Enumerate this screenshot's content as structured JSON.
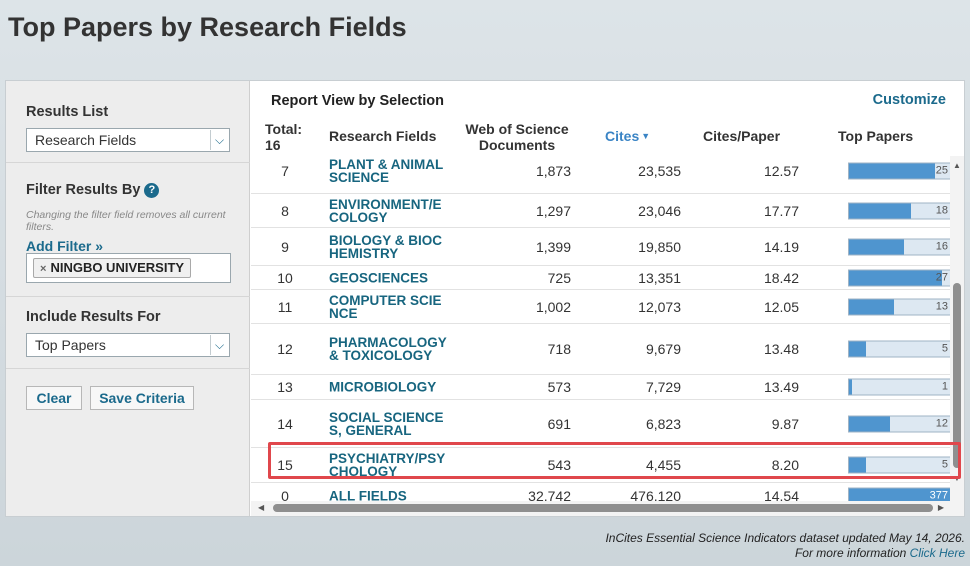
{
  "page": {
    "title": "Top Papers by Research Fields"
  },
  "sidebar": {
    "results_list_label": "Results List",
    "results_list_value": "Research Fields",
    "filter_label": "Filter Results By",
    "filter_help": "?",
    "filter_hint": "Changing the filter field removes all current filters.",
    "add_filter": "Add Filter »",
    "filter_chip_x": "×",
    "filter_chip": "NINGBO UNIVERSITY",
    "include_label": "Include Results For",
    "include_value": "Top Papers",
    "clear_button": "Clear",
    "save_button": "Save Criteria"
  },
  "report": {
    "title": "Report View by Selection",
    "customize": "Customize",
    "columns": {
      "total": "Total: 16",
      "field": "Research Fields",
      "docs": "Web of Science Documents",
      "cites": "Cites",
      "cites_sort": "▼",
      "cpp": "Cites/Paper",
      "top": "Top Papers"
    },
    "rows": [
      {
        "rank": "7",
        "field": "PLANT & ANIMAL SCIENCE",
        "docs": "1,873",
        "cites": "23,535",
        "cpp": "12.57",
        "top": "25",
        "top_value": 25
      },
      {
        "rank": "8",
        "field": "ENVIRONMENT/ECOLOGY",
        "docs": "1,297",
        "cites": "23,046",
        "cpp": "17.77",
        "top": "18",
        "top_value": 18
      },
      {
        "rank": "9",
        "field": "BIOLOGY & BIOCHEMISTRY",
        "docs": "1,399",
        "cites": "19,850",
        "cpp": "14.19",
        "top": "16",
        "top_value": 16
      },
      {
        "rank": "10",
        "field": "GEOSCIENCES",
        "docs": "725",
        "cites": "13,351",
        "cpp": "18.42",
        "top": "27",
        "top_value": 27
      },
      {
        "rank": "11",
        "field": "COMPUTER SCIENCE",
        "docs": "1,002",
        "cites": "12,073",
        "cpp": "12.05",
        "top": "13",
        "top_value": 13
      },
      {
        "rank": "12",
        "field": "PHARMACOLOGY & TOXICOLOGY",
        "docs": "718",
        "cites": "9,679",
        "cpp": "13.48",
        "top": "5",
        "top_value": 5
      },
      {
        "rank": "13",
        "field": "MICROBIOLOGY",
        "docs": "573",
        "cites": "7,729",
        "cpp": "13.49",
        "top": "1",
        "top_value": 1
      },
      {
        "rank": "14",
        "field": "SOCIAL SCIENCES, GENERAL",
        "docs": "691",
        "cites": "6,823",
        "cpp": "9.87",
        "top": "12",
        "top_value": 12
      },
      {
        "rank": "15",
        "field": "PSYCHIATRY/PSYCHOLOGY",
        "docs": "543",
        "cites": "4,455",
        "cpp": "8.20",
        "top": "5",
        "top_value": 5
      },
      {
        "rank": "0",
        "field": "ALL FIELDS",
        "docs": "32,742",
        "cites": "476,120",
        "cpp": "14.54",
        "top": "377",
        "top_value": 377
      }
    ]
  },
  "footer": {
    "line1": "InCites Essential Science Indicators dataset updated May 14, 2026.",
    "line2": "For more information",
    "link": "Click Here"
  },
  "colors": {
    "accent": "#1b6a8c",
    "bar": "#4f95cf",
    "highlight": "#e0474c"
  }
}
